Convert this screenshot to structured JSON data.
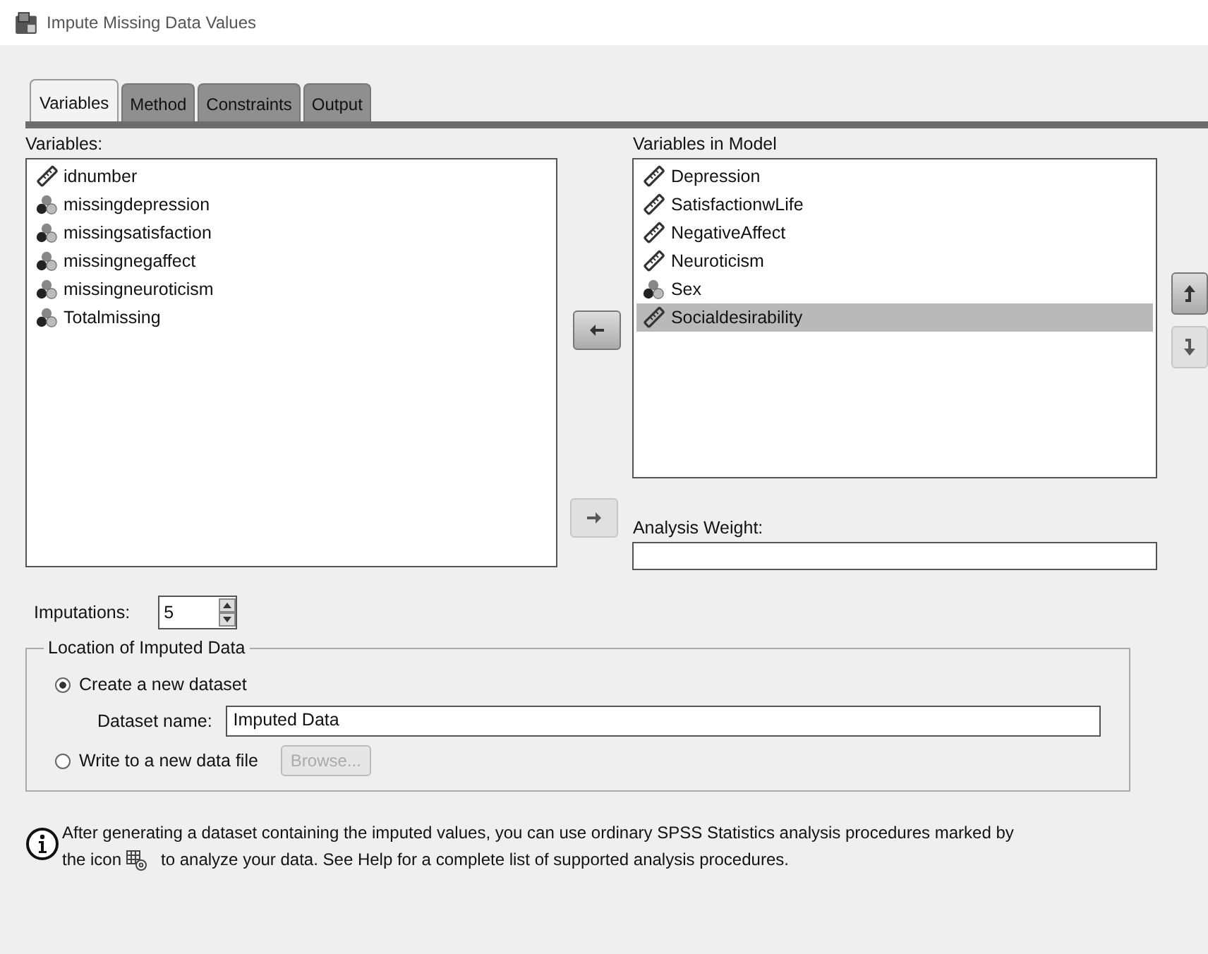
{
  "window": {
    "title": "Impute Missing Data Values"
  },
  "tabs": [
    {
      "label": "Variables",
      "selected": true
    },
    {
      "label": "Method",
      "selected": false
    },
    {
      "label": "Constraints",
      "selected": false
    },
    {
      "label": "Output",
      "selected": false
    }
  ],
  "variables": {
    "label": "Variables:",
    "items": [
      {
        "name": "idnumber",
        "kind": "scale"
      },
      {
        "name": "missingdepression",
        "kind": "nominal"
      },
      {
        "name": "missingsatisfaction",
        "kind": "nominal"
      },
      {
        "name": "missingnegaffect",
        "kind": "nominal"
      },
      {
        "name": "missingneuroticism",
        "kind": "nominal"
      },
      {
        "name": "Totalmissing",
        "kind": "nominal"
      }
    ]
  },
  "move_buttons": [
    {
      "kind": "left",
      "disabled": false
    },
    {
      "kind": "right",
      "disabled": true
    }
  ],
  "model": {
    "label": "Variables in Model",
    "items": [
      {
        "name": "Depression",
        "kind": "scale",
        "selected": false
      },
      {
        "name": "SatisfactionwLife",
        "kind": "scale",
        "selected": false
      },
      {
        "name": "NegativeAffect",
        "kind": "scale",
        "selected": false
      },
      {
        "name": "Neuroticism",
        "kind": "scale",
        "selected": false
      },
      {
        "name": "Sex",
        "kind": "nominal",
        "selected": false
      },
      {
        "name": "Socialdesirability",
        "kind": "scale",
        "selected": true
      }
    ]
  },
  "order_buttons": [
    {
      "kind": "up",
      "disabled": false
    },
    {
      "kind": "down",
      "disabled": true
    }
  ],
  "analysis_weight": {
    "label": "Analysis Weight:"
  },
  "imputations": {
    "label": "Imputations:",
    "value": "5"
  },
  "location": {
    "title": "Location of Imputed Data",
    "options": [
      {
        "label": "Create a new dataset",
        "selected": true
      },
      {
        "label": "Write to a new data file",
        "selected": false
      }
    ],
    "dataset_name": {
      "label": "Dataset name:",
      "value": "Imputed Data"
    },
    "browse": {
      "label": "Browse...",
      "disabled": true
    }
  },
  "info": {
    "line1": "After generating a dataset containing the imputed values, you can use ordinary SPSS Statistics analysis procedures marked by",
    "line2_before": "the icon",
    "line2_after": "to analyze your data. See Help for a complete list of supported analysis procedures."
  }
}
